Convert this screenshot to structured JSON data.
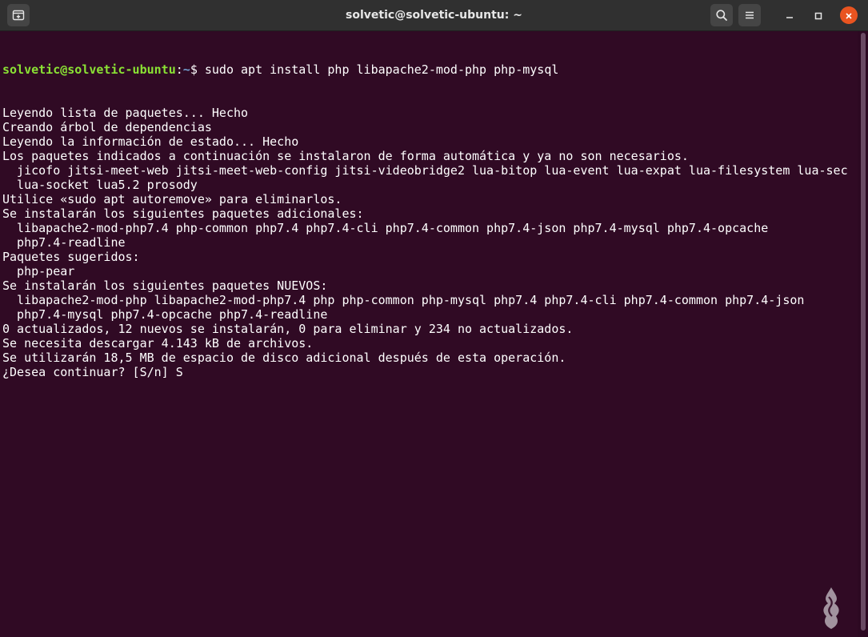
{
  "window": {
    "title": "solvetic@solvetic-ubuntu: ~"
  },
  "titlebar": {
    "new_tab_icon": "new-tab-icon",
    "search_icon": "search-icon",
    "menu_icon": "hamburger-menu-icon",
    "minimize_icon": "minimize-icon",
    "maximize_icon": "maximize-icon",
    "close_icon": "close-icon"
  },
  "colors": {
    "terminal_background": "#300a24",
    "prompt_user": "#8ae234",
    "prompt_path": "#729fcf",
    "close_button": "#e95420"
  },
  "terminal": {
    "prompt": {
      "user_host": "solvetic@solvetic-ubuntu",
      "separator": ":",
      "path": "~",
      "symbol": "$",
      "command": " sudo apt install php libapache2-mod-php php-mysql"
    },
    "lines": [
      "Leyendo lista de paquetes... Hecho",
      "Creando árbol de dependencias",
      "Leyendo la información de estado... Hecho",
      "Los paquetes indicados a continuación se instalaron de forma automática y ya no son necesarios.",
      "  jicofo jitsi-meet-web jitsi-meet-web-config jitsi-videobridge2 lua-bitop lua-event lua-expat lua-filesystem lua-sec",
      "  lua-socket lua5.2 prosody",
      "Utilice «sudo apt autoremove» para eliminarlos.",
      "Se instalarán los siguientes paquetes adicionales:",
      "  libapache2-mod-php7.4 php-common php7.4 php7.4-cli php7.4-common php7.4-json php7.4-mysql php7.4-opcache",
      "  php7.4-readline",
      "Paquetes sugeridos:",
      "  php-pear",
      "Se instalarán los siguientes paquetes NUEVOS:",
      "  libapache2-mod-php libapache2-mod-php7.4 php php-common php-mysql php7.4 php7.4-cli php7.4-common php7.4-json",
      "  php7.4-mysql php7.4-opcache php7.4-readline",
      "0 actualizados, 12 nuevos se instalarán, 0 para eliminar y 234 no actualizados.",
      "Se necesita descargar 4.143 kB de archivos.",
      "Se utilizarán 18,5 MB de espacio de disco adicional después de esta operación.",
      "¿Desea continuar? [S/n] S"
    ]
  },
  "watermark": {
    "icon": "solvetic-logo"
  }
}
